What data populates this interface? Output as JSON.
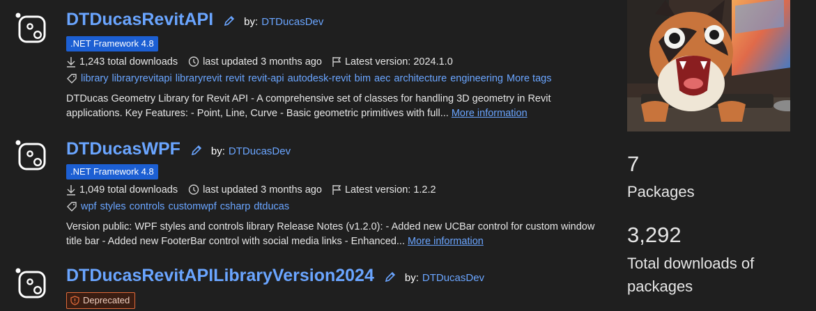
{
  "packages": [
    {
      "title": "DTDucasRevitAPI",
      "by": "by:",
      "author": "DTDucasDev",
      "badge": ".NET Framework 4.8",
      "downloads": "1,243 total downloads",
      "updated": "last updated 3 months ago",
      "version": "Latest version: 2024.1.0",
      "tags": [
        "library",
        "libraryrevitapi",
        "libraryrevit",
        "revit",
        "revit-api",
        "autodesk-revit",
        "bim",
        "aec",
        "architecture",
        "engineering"
      ],
      "more_tags": "More tags",
      "desc_line1": "DTDucas Geometry Library for Revit API - A comprehensive set of classes for handling 3D geometry in Revit",
      "desc_line2": "applications. Key Features: - Point, Line, Curve - Basic geometric primitives with full...",
      "more_info": "More information"
    },
    {
      "title": "DTDucasWPF",
      "by": "by:",
      "author": "DTDucasDev",
      "badge": ".NET Framework 4.8",
      "downloads": "1,049 total downloads",
      "updated": "last updated 3 months ago",
      "version": "Latest version: 1.2.2",
      "tags": [
        "wpf",
        "styles",
        "controls",
        "customwpf",
        "csharp",
        "dtducas"
      ],
      "desc_line1": "Version public: WPF styles and controls library Release Notes (v1.2.0): - Added new UCBar control for custom window",
      "desc_line2": "title bar - Added new FooterBar control with social media links - Enhanced...",
      "more_info": "More information"
    },
    {
      "title": "DTDucasRevitAPILibraryVersion2024",
      "by": "by:",
      "author": "DTDucasDev",
      "badge": "Deprecated"
    }
  ],
  "stats": {
    "packages_count": "7",
    "packages_label": "Packages",
    "downloads_count": "3,292",
    "downloads_label": "Total downloads of packages"
  },
  "icons": {
    "package": "package-icon",
    "edit": "pencil-icon",
    "download": "download-icon",
    "history": "history-icon",
    "flag": "flag-icon",
    "tag": "tag-icon",
    "deprecated": "shield-warning-icon"
  },
  "colors": {
    "link": "#6aa5ff",
    "badge": "#1c5fd3",
    "background": "#1f1f1f",
    "deprecated_border": "#e06a3a"
  }
}
